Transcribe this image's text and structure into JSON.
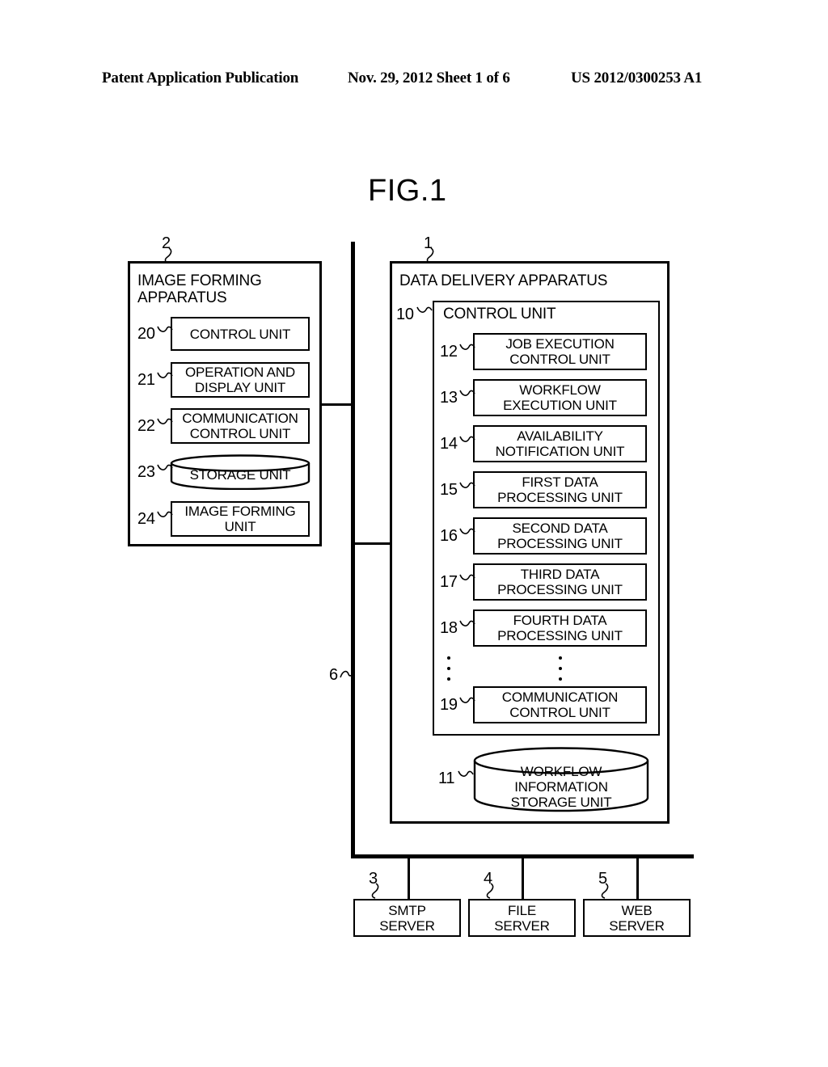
{
  "header": {
    "left": "Patent Application Publication",
    "middle": "Nov. 29, 2012  Sheet 1 of 6",
    "right": "US 2012/0300253 A1"
  },
  "figure": {
    "title": "FIG.1",
    "network_bus_ref": "6",
    "image_forming_apparatus": {
      "ref": "2",
      "title": "IMAGE FORMING\nAPPARATUS",
      "units": [
        {
          "ref": "20",
          "label": "CONTROL UNIT",
          "shape": "rect"
        },
        {
          "ref": "21",
          "label": "OPERATION AND\nDISPLAY UNIT",
          "shape": "rect"
        },
        {
          "ref": "22",
          "label": "COMMUNICATION\nCONTROL UNIT",
          "shape": "rect"
        },
        {
          "ref": "23",
          "label": "STORAGE UNIT",
          "shape": "cylinder"
        },
        {
          "ref": "24",
          "label": "IMAGE FORMING\nUNIT",
          "shape": "rect"
        }
      ]
    },
    "data_delivery_apparatus": {
      "ref": "1",
      "title": "DATA DELIVERY APPARATUS",
      "control_unit": {
        "ref": "10",
        "title": "CONTROL UNIT",
        "units": [
          {
            "ref": "12",
            "label": "JOB EXECUTION\nCONTROL UNIT"
          },
          {
            "ref": "13",
            "label": "WORKFLOW\nEXECUTION UNIT"
          },
          {
            "ref": "14",
            "label": "AVAILABILITY\nNOTIFICATION UNIT"
          },
          {
            "ref": "15",
            "label": "FIRST DATA\nPROCESSING UNIT"
          },
          {
            "ref": "16",
            "label": "SECOND DATA\nPROCESSING UNIT"
          },
          {
            "ref": "17",
            "label": "THIRD DATA\nPROCESSING UNIT"
          },
          {
            "ref": "18",
            "label": "FOURTH DATA\nPROCESSING UNIT"
          },
          {
            "ref": "19",
            "label": "COMMUNICATION\nCONTROL UNIT"
          }
        ],
        "ellipsis": "⋮"
      },
      "storage": {
        "ref": "11",
        "label": "WORKFLOW\nINFORMATION\nSTORAGE UNIT",
        "shape": "cylinder"
      }
    },
    "servers": [
      {
        "ref": "3",
        "label": "SMTP\nSERVER"
      },
      {
        "ref": "4",
        "label": "FILE\nSERVER"
      },
      {
        "ref": "5",
        "label": "WEB\nSERVER"
      }
    ]
  }
}
